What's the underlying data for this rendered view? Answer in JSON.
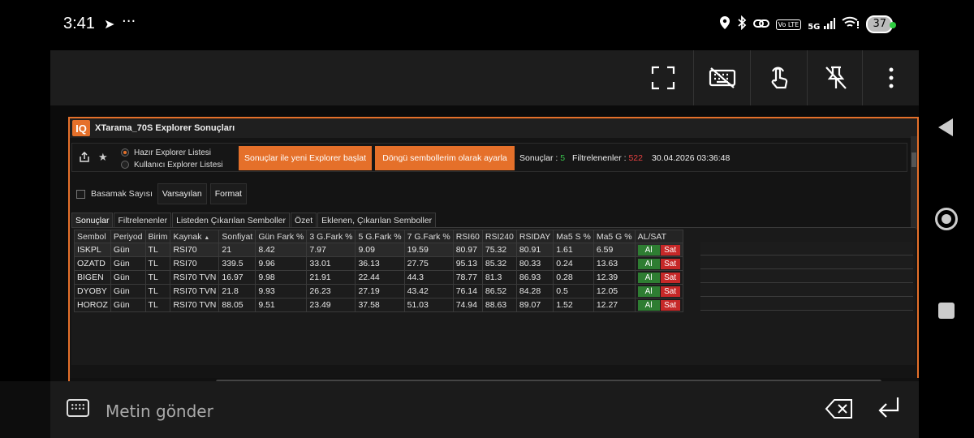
{
  "status_bar": {
    "time": "3:41",
    "dots": "···",
    "network": "5G",
    "volte": "Vo LTE",
    "battery": "37"
  },
  "window": {
    "logo": "IQ",
    "title": "XTarama_70S Explorer Sonuçları"
  },
  "toolbar": {
    "radio_ready": "Hazır Explorer Listesi",
    "radio_user": "Kullanıcı Explorer Listesi",
    "btn_new_explorer": "Sonuçlar ile yeni Explorer başlat",
    "btn_cycle_symbols": "Döngü sembollerim olarak ayarla",
    "results_label": "Sonuçlar :",
    "results_count": "5",
    "filtered_label": "Filtrelenenler :",
    "filtered_count": "522",
    "timestamp": "30.04.2026 03:36:48"
  },
  "options": {
    "basamak": "Basamak Sayısı",
    "varsayilan": "Varsayılan",
    "format": "Format"
  },
  "tabs": [
    "Sonuçlar",
    "Filtrelenenler",
    "Listeden Çıkarılan Semboller",
    "Özet",
    "Eklenen, Çıkarılan Semboller"
  ],
  "table": {
    "columns": [
      "Sembol",
      "Periyod",
      "Birim",
      "Kaynak",
      "Sonfiyat",
      "Gün Fark %",
      "3 G.Fark %",
      "5 G.Fark %",
      "7 G.Fark %",
      "RSI60",
      "RSI240",
      "RSIDAY",
      "Ma5 S %",
      "Ma5 G %",
      "AL/SAT"
    ],
    "buy_label": "Al",
    "sell_label": "Sat",
    "rows": [
      [
        "ISKPL",
        "Gün",
        "TL",
        "RSI70",
        "21",
        "8.42",
        "7.97",
        "9.09",
        "19.59",
        "80.97",
        "75.32",
        "80.91",
        "1.61",
        "6.59"
      ],
      [
        "OZATD",
        "Gün",
        "TL",
        "RSI70",
        "339.5",
        "9.96",
        "33.01",
        "36.13",
        "27.75",
        "95.13",
        "85.32",
        "80.33",
        "0.24",
        "13.63"
      ],
      [
        "BIGEN",
        "Gün",
        "TL",
        "RSI70 TVN",
        "16.97",
        "9.98",
        "21.91",
        "22.44",
        "44.3",
        "78.77",
        "81.3",
        "86.93",
        "0.28",
        "12.39"
      ],
      [
        "DYOBY",
        "Gün",
        "TL",
        "RSI70 TVN",
        "21.8",
        "9.93",
        "26.23",
        "27.19",
        "43.42",
        "76.14",
        "86.52",
        "84.28",
        "0.5",
        "12.05"
      ],
      [
        "HOROZ",
        "Gün",
        "TL",
        "RSI70 TVN",
        "88.05",
        "9.51",
        "23.49",
        "37.58",
        "51.03",
        "74.94",
        "88.63",
        "89.07",
        "1.52",
        "12.27"
      ]
    ]
  },
  "bottom_bar": {
    "placeholder": "Metin gönder"
  },
  "colors": {
    "accent": "#e5702a",
    "buy": "#2e7d32",
    "sell": "#c62828",
    "results_count": "#39c24b",
    "filtered_count": "#e64040"
  },
  "icons": [
    "navigation-arrow-icon",
    "location-icon",
    "bluetooth-icon",
    "link-icon",
    "wifi-icon",
    "fullscreen-icon",
    "keyboard-off-icon",
    "touch-icon",
    "pin-off-icon",
    "more-vert-icon",
    "share-icon",
    "star-icon",
    "keyboard-icon",
    "backspace-icon",
    "enter-icon",
    "back-icon",
    "home-icon",
    "recent-apps-icon"
  ]
}
